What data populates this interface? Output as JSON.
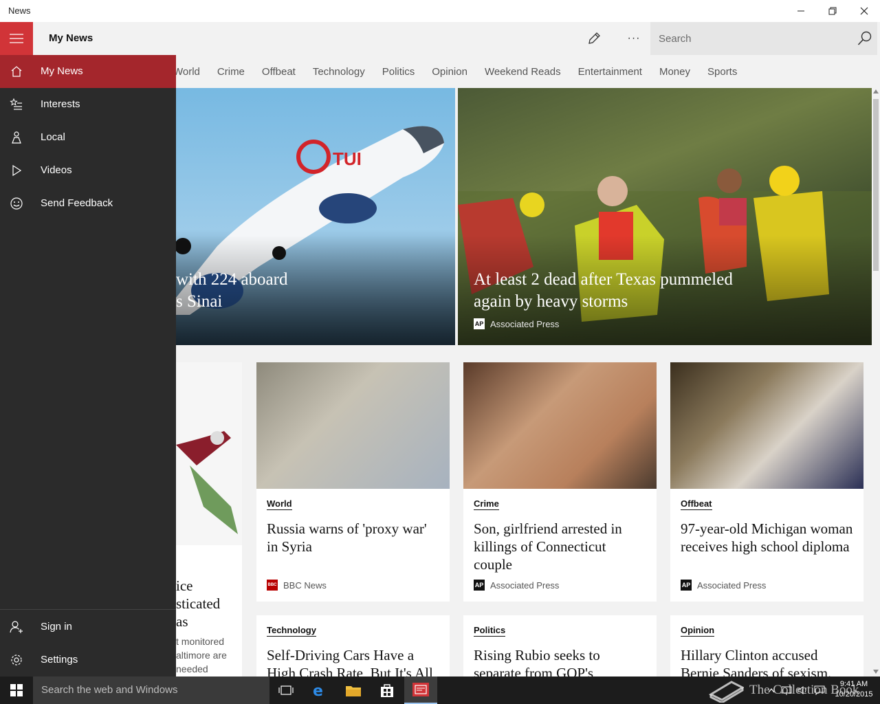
{
  "window": {
    "title": "News"
  },
  "header": {
    "page_title": "My News",
    "search_placeholder": "Search",
    "more_label": "···"
  },
  "tabs": [
    "World",
    "Crime",
    "Offbeat",
    "Technology",
    "Politics",
    "Opinion",
    "Weekend Reads",
    "Entertainment",
    "Money",
    "Sports"
  ],
  "nav": {
    "items": [
      "My News",
      "Interests",
      "Local",
      "Videos",
      "Send Feedback"
    ],
    "bottom_items": [
      "Sign in",
      "Settings"
    ],
    "selected": "My News"
  },
  "hero": [
    {
      "title_lines": [
        "with 224 aboard",
        "s Sinai"
      ]
    },
    {
      "title_lines": [
        "At least 2 dead after Texas pummeled",
        "again by heavy storms"
      ],
      "source": "Associated Press",
      "source_logo": "AP"
    }
  ],
  "cards_row1": [
    {
      "category": "World",
      "title": "Russia warns of 'proxy war' in Syria",
      "source": "BBC News",
      "source_logo": "BBC"
    },
    {
      "category": "Crime",
      "title": "Son, girlfriend arrested in killings of Connecticut couple",
      "source": "Associated Press",
      "source_logo": "AP"
    },
    {
      "category": "Offbeat",
      "title": "97-year-old Michigan woman receives high school diploma",
      "source": "Associated Press",
      "source_logo": "AP"
    }
  ],
  "partial_card": {
    "title_lines": [
      "ice",
      "sticated",
      "as"
    ],
    "body_lines": [
      "t monitored",
      "altimore are",
      "needed"
    ]
  },
  "cards_row2": [
    {
      "category": "Technology",
      "title": "Self-Driving Cars Have a High Crash Rate, But It's All"
    },
    {
      "category": "Politics",
      "title": "Rising Rubio seeks to separate from GOP's"
    },
    {
      "category": "Opinion",
      "title": "Hillary Clinton accused Bernie Sanders of sexism."
    }
  ],
  "taskbar": {
    "search_placeholder": "Search the web and Windows",
    "time": "9:41 AM",
    "date": "10/20/2015"
  },
  "watermark": "The Collection Book",
  "colors": {
    "accent": "#d13438",
    "nav_selected": "#a4262c",
    "nav_bg": "#2b2b2b",
    "taskbar": "#1c1c1c"
  }
}
